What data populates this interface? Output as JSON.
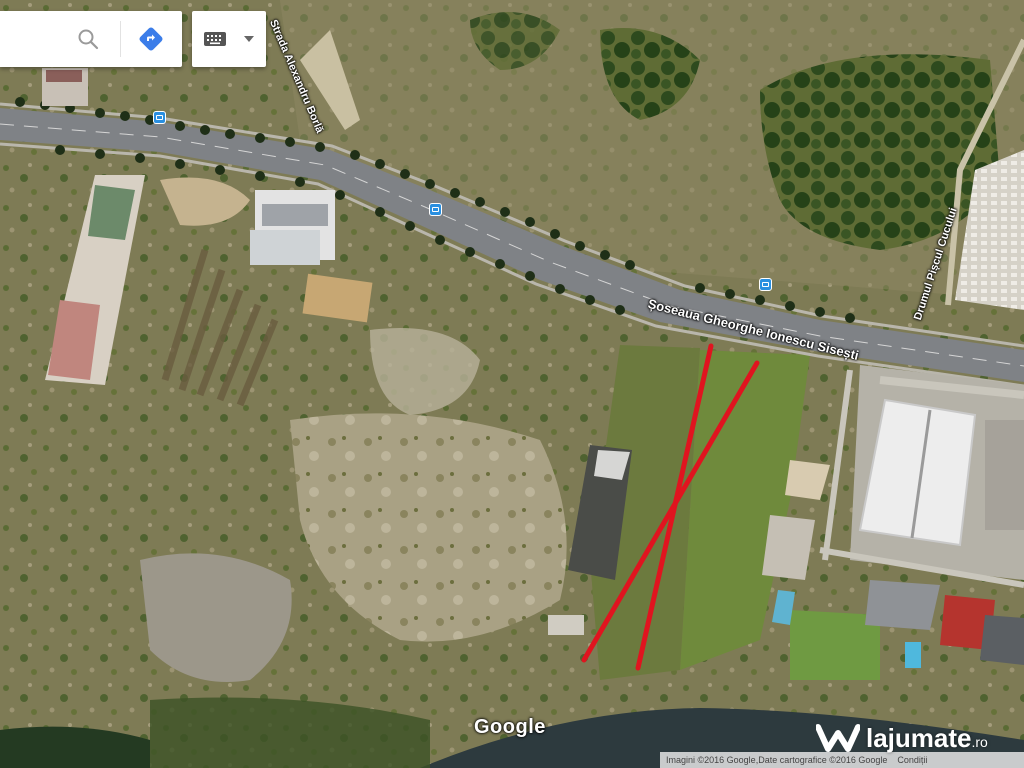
{
  "search": {
    "placeholder": "",
    "value": ""
  },
  "icons": {
    "search": "search-icon",
    "directions": "directions-icon",
    "keyboard": "keyboard-icon",
    "dropdown": "caret-down-icon",
    "bus": "bus-stop-icon"
  },
  "colors": {
    "directions_blue": "#3b7de9",
    "route_marker_red": "#e0141f",
    "bus_stop_blue": "#2a8fe0"
  },
  "map": {
    "road_labels": {
      "main": "Șoseaua Gheorghe Ionescu Sisești",
      "upper_left": "Strada Alexandru Borlă",
      "right": "Drumul Pișcul Cucului"
    },
    "logo": "Google",
    "attribution": {
      "imagery": "Imagini ©2016 Google,Date cartografice ©2016 Google",
      "terms": "Condiții"
    }
  },
  "watermark": {
    "brand": "lajumate",
    "suffix": ".ro"
  }
}
